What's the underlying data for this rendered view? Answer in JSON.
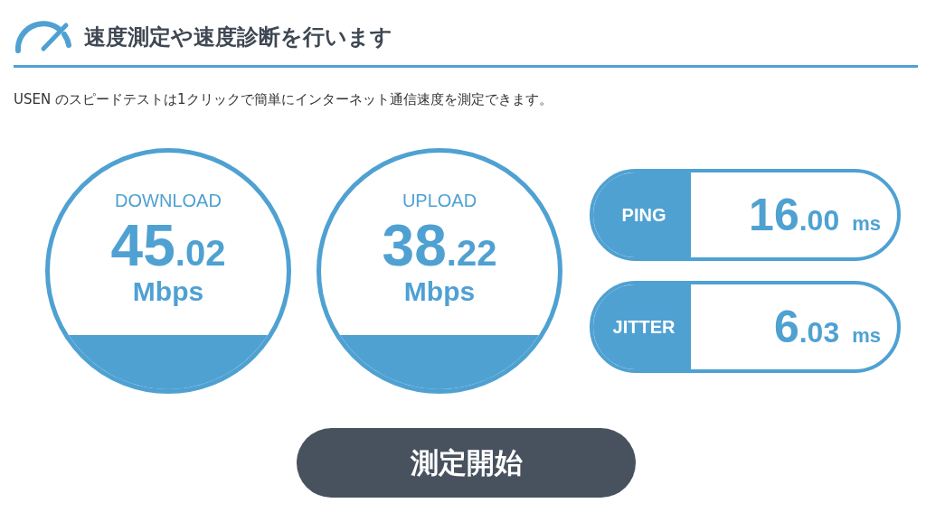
{
  "header": {
    "title": "速度測定や速度診断を行います"
  },
  "description": "USEN のスピードテストは1クリックで簡単にインターネット通信速度を測定できます。",
  "gauges": [
    {
      "label": "DOWNLOAD",
      "whole": "45",
      "decimal": ".02",
      "unit": "Mbps"
    },
    {
      "label": "UPLOAD",
      "whole": "38",
      "decimal": ".22",
      "unit": "Mbps"
    }
  ],
  "metrics": [
    {
      "label": "PING",
      "whole": "16",
      "decimal": ".00",
      "unit": "ms"
    },
    {
      "label": "JITTER",
      "whole": "6",
      "decimal": ".03",
      "unit": "ms"
    }
  ],
  "start_button": "測定開始"
}
